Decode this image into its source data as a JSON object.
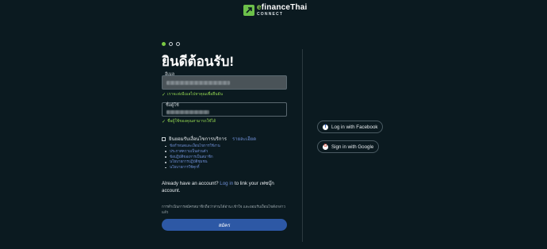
{
  "brand": {
    "name_prefix": "e",
    "name_rest": "financeThai",
    "sub": "CONNECT",
    "accent": "#6cc04a"
  },
  "steps": {
    "total": 3,
    "active": 1
  },
  "title": "ยินดีต้อนรับ!",
  "email_field": {
    "label": "อีเมล",
    "hint": "เราจะส่งอีเมลไปหาคุณเพื่อยืนยัน"
  },
  "username_field": {
    "label": "ชื่อผู้ใช้",
    "hint": "ชื่อผู้ใช้ของคุณสามารถใช้ได้"
  },
  "terms": {
    "label": "ยินยอมรับเงื่อนไขการบริการ",
    "details_link": "รายละเอียด"
  },
  "documents": [
    "ข้อกำหนดและเงื่อนไขการใช้งาน",
    "ประกาศความเป็นส่วนตัว",
    "ข้อปฏิบัติของการเป็นสมาชิก",
    "นโยบายการปฏิบัติชุมชน",
    "นโยบายการใช้คุกกี้"
  ],
  "already": {
    "prefix": "Already have an account?",
    "login_link": "Log in",
    "suffix": "to link your เฟซบุ๊ก account."
  },
  "consent_note": "การดำเนินการสมัครสมาชิกถือว่าท่านได้อ่าน เข้าใจ และยอมรับเงื่อนไขดังกล่าวแล้ว",
  "submit_label": "สมัคร",
  "social": {
    "facebook_label": "Log in with Facebook",
    "google_label": "Sign in with Google"
  },
  "colors": {
    "background": "#0b1a20",
    "link": "#6f8fd6",
    "primary": "#2d58a5",
    "success": "#8fd14f"
  }
}
